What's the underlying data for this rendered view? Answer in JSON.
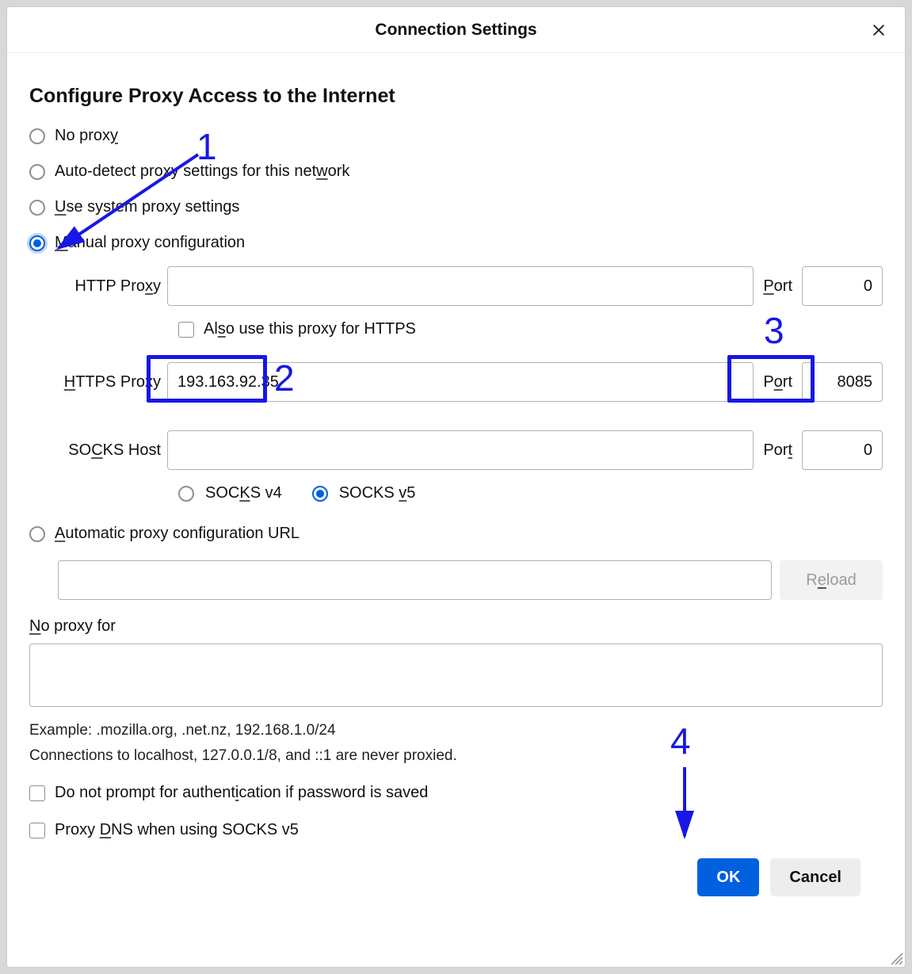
{
  "dialog": {
    "title": "Connection Settings",
    "close_label": "Close"
  },
  "section": {
    "heading": "Configure Proxy Access to the Internet"
  },
  "radios": {
    "no_proxy": "No proxy",
    "auto_detect": "Auto-detect proxy settings for this network",
    "use_system": "Use system proxy settings",
    "manual": "Manual proxy configuration",
    "auto_url": "Automatic proxy configuration URL"
  },
  "proxy": {
    "http_label": "HTTP Proxy",
    "http_host": "",
    "http_port": "0",
    "also_https": "Also use this proxy for HTTPS",
    "https_label": "HTTPS Proxy",
    "https_host": "193.163.92.35",
    "https_port": "8085",
    "socks_label": "SOCKS Host",
    "socks_host": "",
    "socks_port": "0",
    "socks_v4": "SOCKS v4",
    "socks_v5": "SOCKS v5",
    "port_label": "Port",
    "auto_url_value": "",
    "reload": "Reload"
  },
  "noproxy": {
    "label": "No proxy for",
    "value": "",
    "example": "Example: .mozilla.org, .net.nz, 192.168.1.0/24",
    "localhost_note": "Connections to localhost, 127.0.0.1/8, and ::1 are never proxied."
  },
  "checks": {
    "no_auth_prompt": "Do not prompt for authentication if password is saved",
    "proxy_dns_socks5": "Proxy DNS when using SOCKS v5"
  },
  "footer": {
    "ok": "OK",
    "cancel": "Cancel"
  },
  "annotations": {
    "n1": "1",
    "n2": "2",
    "n3": "3",
    "n4": "4"
  }
}
